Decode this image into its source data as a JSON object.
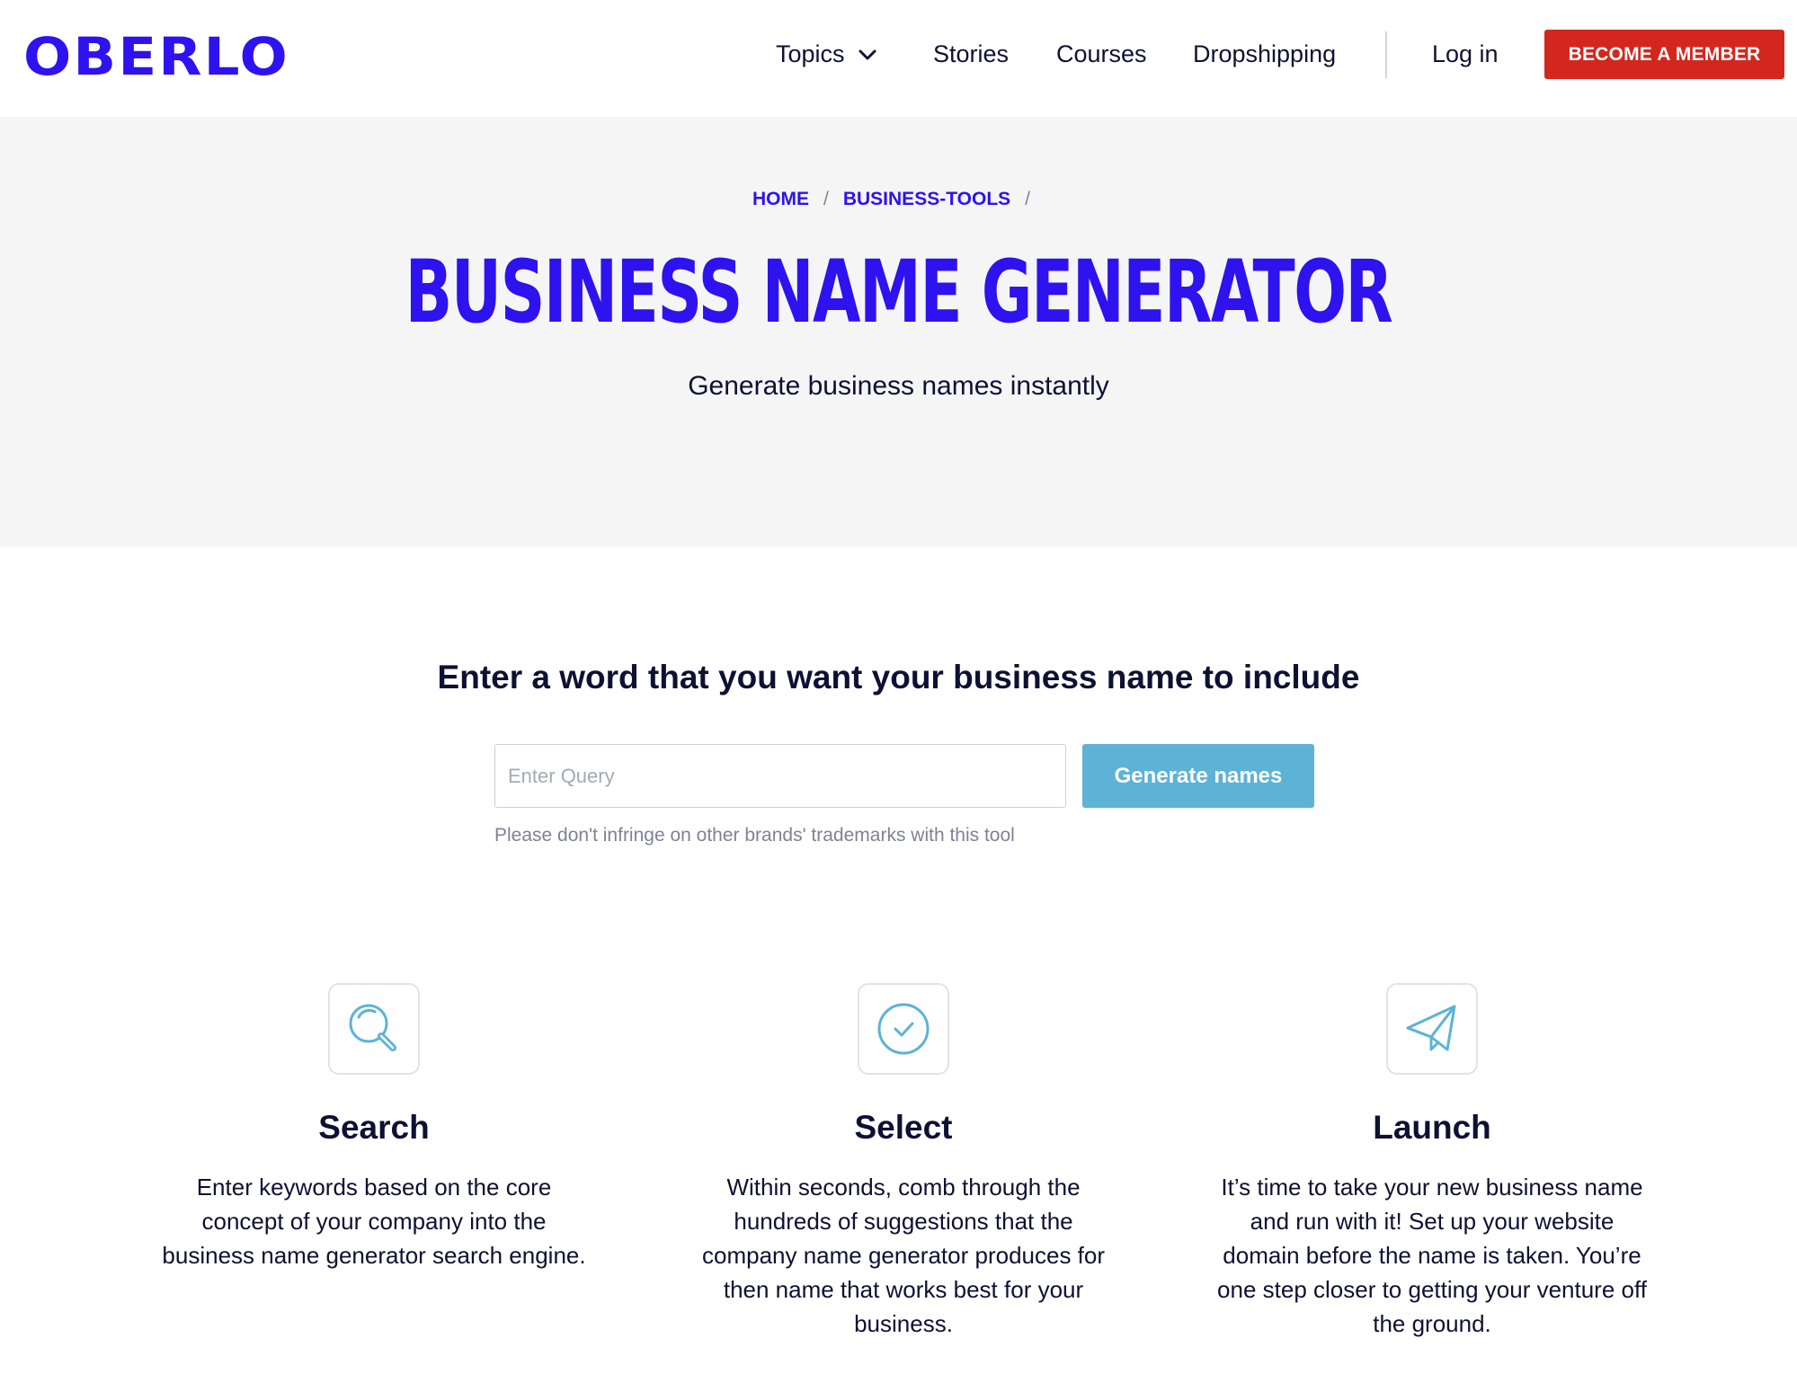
{
  "header": {
    "logo": "OBERLO",
    "nav": {
      "topics": "Topics",
      "stories": "Stories",
      "courses": "Courses",
      "dropshipping": "Dropshipping",
      "login": "Log in",
      "cta": "BECOME A MEMBER"
    }
  },
  "hero": {
    "breadcrumb": [
      "HOME",
      "BUSINESS-TOOLS"
    ],
    "separator": "/",
    "title": "BUSINESS NAME GENERATOR",
    "subtitle": "Generate business names instantly"
  },
  "query": {
    "heading": "Enter a word that you want your business name to include",
    "placeholder": "Enter Query",
    "value": "",
    "button": "Generate names",
    "note": "Please don't infringe on other brands' trademarks with this tool"
  },
  "features": [
    {
      "icon": "search-icon",
      "title": "Search",
      "text": "Enter keywords based on the core concept of your company into the business name generator search engine."
    },
    {
      "icon": "check-circle-icon",
      "title": "Select",
      "text": "Within seconds, comb through the hundreds of suggestions that the company name generator produces for then name that works best for your business."
    },
    {
      "icon": "paper-plane-icon",
      "title": "Launch",
      "text": "It’s time to take your new business name and run with it! Set up your website domain before the name is taken. You’re one step closer to getting your venture off the ground."
    }
  ],
  "colors": {
    "brand": "#2e12ef",
    "cta": "#d3271e",
    "button": "#5db3d5",
    "icon_stroke": "#5db3d5",
    "hero_bg": "#f5f5f6",
    "text": "#0e1133"
  }
}
